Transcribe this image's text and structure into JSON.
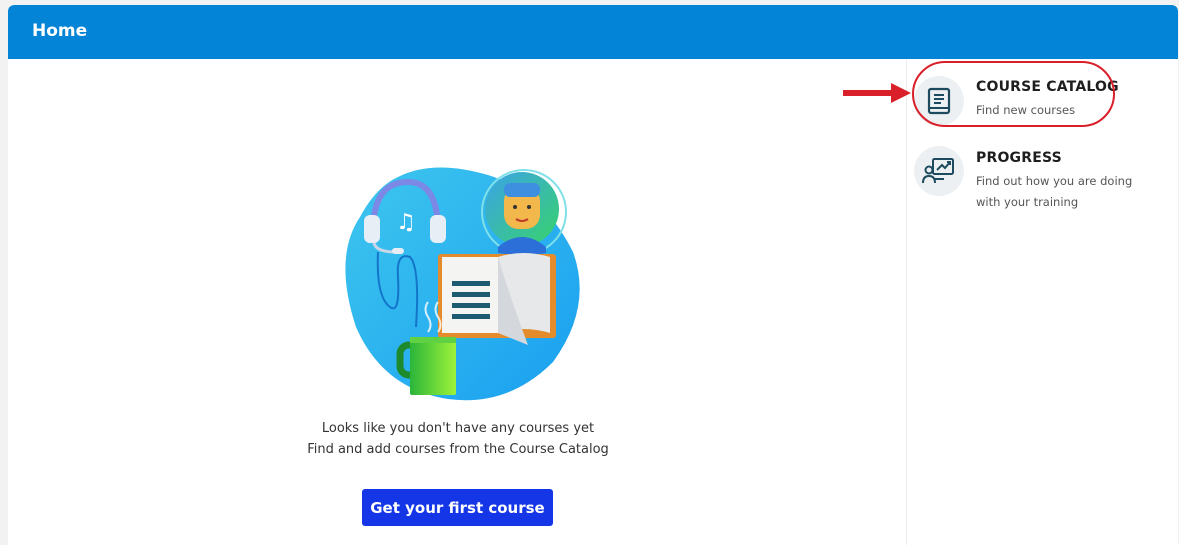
{
  "header": {
    "title": "Home"
  },
  "main": {
    "empty_line1": "Looks like you don't have any courses yet",
    "empty_line2": "Find and add courses from the Course Catalog",
    "cta_label": "Get your first course"
  },
  "sidebar": {
    "items": [
      {
        "title": "COURSE CATALOG",
        "description": "Find new courses",
        "icon": "book-icon"
      },
      {
        "title": "PROGRESS",
        "description": "Find out how you are doing with your training",
        "icon": "progress-chart-icon"
      }
    ]
  },
  "colors": {
    "header": "#0384d6",
    "button": "#1536e6",
    "highlight": "#d91f2a",
    "icon": "#1d4a5e"
  }
}
